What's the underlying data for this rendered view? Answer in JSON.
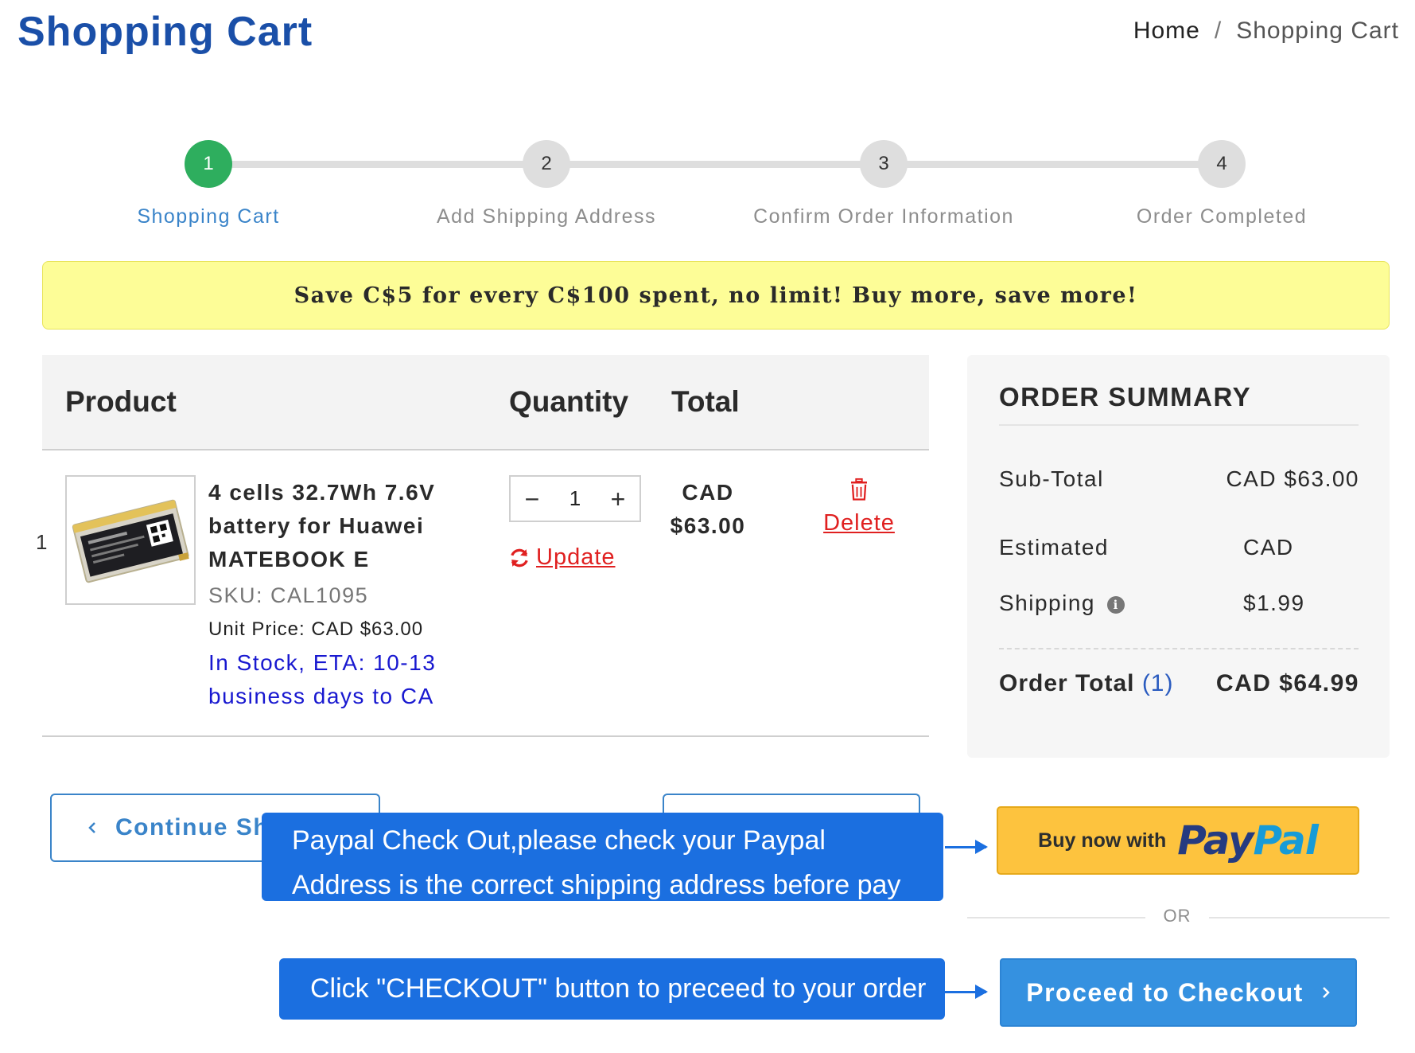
{
  "header": {
    "title": "Shopping Cart",
    "breadcrumb": {
      "home": "Home",
      "separator": "/",
      "current": "Shopping Cart"
    }
  },
  "steps": [
    {
      "number": "1",
      "label": "Shopping Cart",
      "active": true
    },
    {
      "number": "2",
      "label": "Add Shipping Address",
      "active": false
    },
    {
      "number": "3",
      "label": "Confirm Order Information",
      "active": false
    },
    {
      "number": "4",
      "label": "Order Completed",
      "active": false
    }
  ],
  "promo": {
    "text": "Save C$5 for every C$100 spent, no limit! Buy more, save more!"
  },
  "table": {
    "headers": {
      "product": "Product",
      "quantity": "Quantity",
      "total": "Total"
    },
    "rows": [
      {
        "index": "1",
        "name": "4 cells 32.7Wh 7.6V battery for Huawei MATEBOOK E",
        "sku": "SKU: CAL1095",
        "unit_price": "Unit Price: CAD $63.00",
        "stock": "In Stock, ETA: 10-13 business days to CA",
        "quantity": "1",
        "total_currency": "CAD",
        "total_amount": "$63.00",
        "update_label": "Update",
        "delete_label": "Delete",
        "minus_symbol": "−",
        "plus_symbol": "+"
      }
    ]
  },
  "summary": {
    "title": "ORDER SUMMARY",
    "subtotal_label": "Sub-Total",
    "subtotal_value": "CAD $63.00",
    "shipping_label_1": "Estimated",
    "shipping_label_2": "Shipping",
    "shipping_currency": "CAD",
    "shipping_amount": "$1.99",
    "order_total_label": "Order Total",
    "order_total_count": "(1)",
    "order_total_value": "CAD $64.99"
  },
  "actions": {
    "continue_label": "Continue Sh",
    "paypal_prefix": "Buy now with",
    "paypal_pay": "Pay",
    "paypal_pal": "Pal",
    "or_text": "OR",
    "checkout_label": "Proceed to Checkout"
  },
  "callouts": {
    "paypal": "Paypal Check Out,please check your Paypal Address is the correct shipping address before pay",
    "checkout": "Click \"CHECKOUT\" button to preceed to your order"
  },
  "colors": {
    "title_blue": "#1a4fa8",
    "step_active": "#2eae5e",
    "link_blue": "#3a84c9",
    "promo_bg": "#fdfd97",
    "delete_red": "#e02020",
    "stock_blue": "#1818d0",
    "callout_blue": "#1b6fe0",
    "paypal_yellow": "#fdc33e",
    "checkout_blue": "#3591e0"
  },
  "icons": {
    "update": "refresh-icon",
    "delete": "trash-icon",
    "info": "info-icon",
    "continue": "chevron-left-icon",
    "checkout": "chevron-right-icon"
  }
}
